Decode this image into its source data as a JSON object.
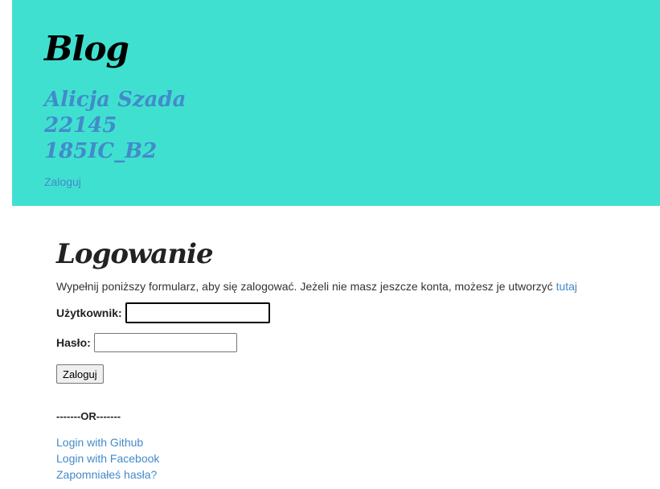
{
  "header": {
    "title": "Blog",
    "author_lines": [
      "Alicja Szada",
      "22145",
      "185IC_B2"
    ],
    "login_link": "Zaloguj"
  },
  "main": {
    "heading": "Logowanie",
    "intro_text": "Wypełnij poniższy formularz, aby się zalogować. Jeżeli nie masz jeszcze konta, możesz je utworzyć",
    "intro_link": "tutaj",
    "form": {
      "username_label": "Użytkownik:",
      "username_value": "",
      "password_label": "Hasło:",
      "password_value": "",
      "submit_label": "Zaloguj"
    },
    "divider": "-------OR-------",
    "links": [
      "Login with Github",
      "Login with Facebook",
      "Zapomniałeś hasła?"
    ]
  },
  "colors": {
    "header_bg": "#40e0d0",
    "link": "#428bca"
  }
}
